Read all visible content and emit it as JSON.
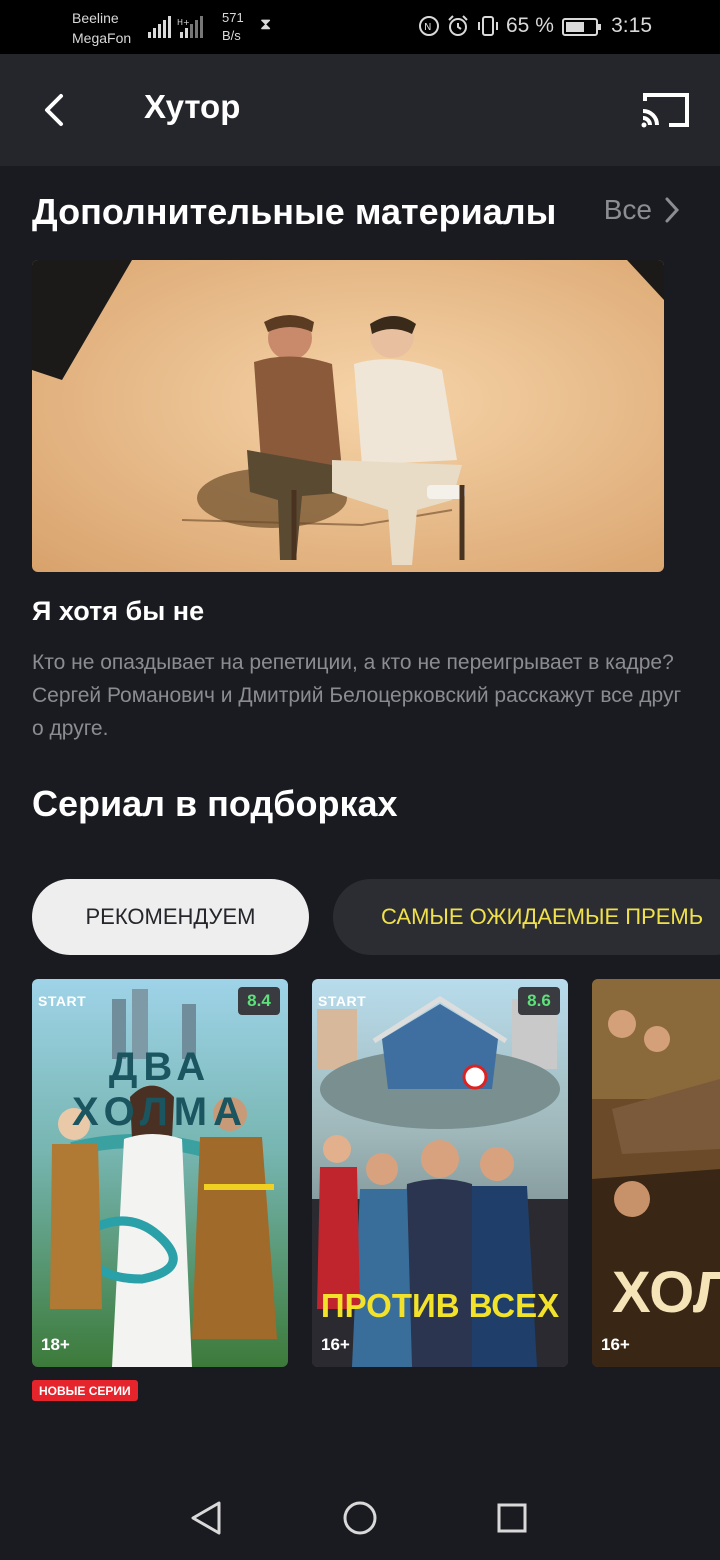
{
  "status_bar": {
    "carrier1": "Beeline",
    "carrier2": "MegaFon",
    "speed_value": "571",
    "speed_unit": "B/s",
    "battery": "65 %",
    "battery_level": 0.65,
    "time": "3:15"
  },
  "header": {
    "title": "Хутор",
    "back_icon": "chevron-left-icon",
    "cast_icon": "cast-icon"
  },
  "extras": {
    "title": "Дополнительные материалы",
    "see_all": "Все",
    "item": {
      "title": "Я хотя бы не",
      "description": "Кто не опаздывает на репетиции, а кто не переигрывает в кадре? Сергей Романович и Дмитрий Белоцерковский расскажут все друг о друге."
    }
  },
  "collections": {
    "title": "Сериал в подборках",
    "tabs": [
      {
        "label": "РЕКОМЕНДУЕМ",
        "active": true
      },
      {
        "label": "САМЫЕ ОЖИДАЕМЫЕ ПРЕМЬ",
        "active": false
      }
    ],
    "posters": [
      {
        "brand": "START",
        "name": "ДВА ХОЛМА",
        "rating": "8.4",
        "age": "18+",
        "badge": "НОВЫЕ СЕРИИ"
      },
      {
        "brand": "START",
        "name": "ПРОТИВ ВСЕХ",
        "rating": "8.6",
        "age": "16+"
      },
      {
        "name": "ХОЛ",
        "age": "16+"
      }
    ]
  },
  "colors": {
    "background": "#1a1b20",
    "appbar": "#25262b",
    "accent_yellow": "#f0e14a",
    "rating_green": "#5ee07a",
    "badge_red": "#e5242c"
  }
}
